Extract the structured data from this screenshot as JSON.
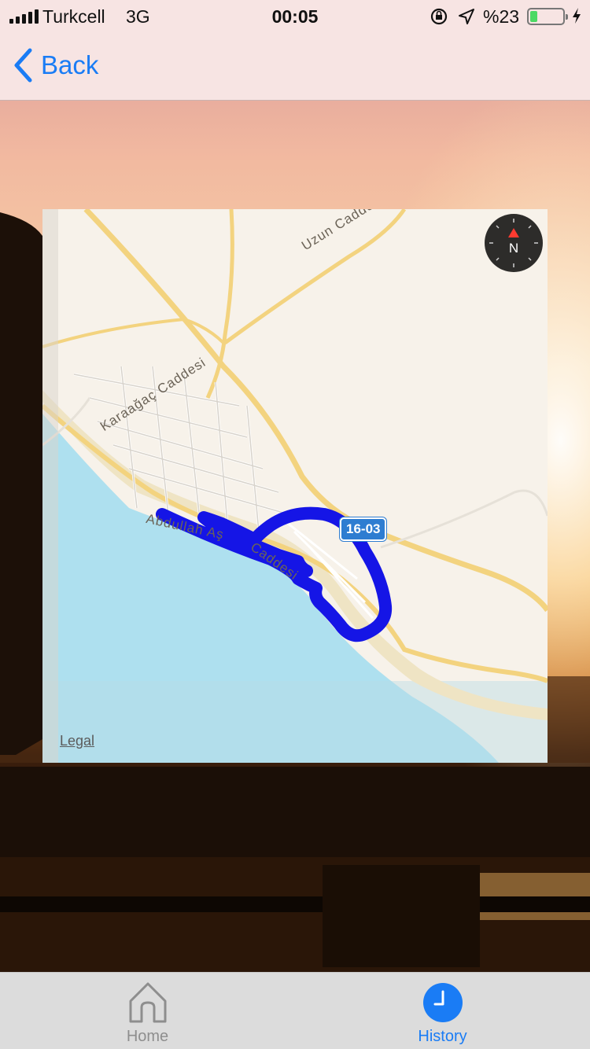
{
  "status_bar": {
    "carrier": "Turkcell",
    "network": "3G",
    "time": "00:05",
    "battery_percent": "%23",
    "battery_level": 0.23,
    "icons": [
      "signal-bars-icon",
      "orientation-lock-icon",
      "location-arrow-icon",
      "battery-icon",
      "charging-bolt-icon"
    ]
  },
  "nav": {
    "back_label": "Back",
    "accent_color": "#1a7cf5"
  },
  "map": {
    "street_labels": {
      "uzun": "Uzun Caddesi",
      "karaagac": "Karaağaç Caddesi",
      "coastal": "Abdullah Aş",
      "coastal_2": "Caddesi"
    },
    "route_shield": "16-03",
    "compass_label": "N",
    "legal_label": "Legal",
    "route_color": "#1515e6"
  },
  "tabbar": {
    "tabs": [
      {
        "label": "Home",
        "icon": "house-icon",
        "selected": false
      },
      {
        "label": "History",
        "icon": "clock-icon",
        "selected": true
      }
    ]
  }
}
